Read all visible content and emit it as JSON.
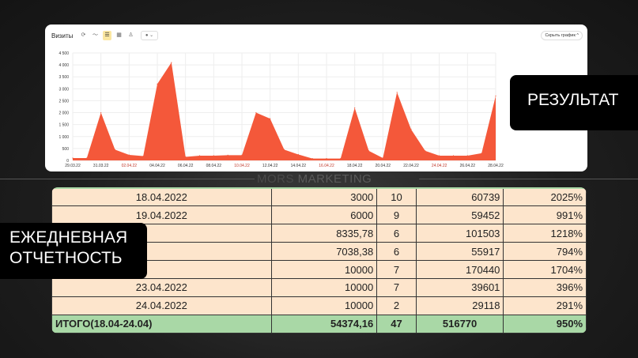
{
  "chart_card": {
    "title": "Визиты",
    "hide_button": "Скрыть график ^"
  },
  "chart_data": {
    "type": "area",
    "title": "Визиты",
    "color": "#f4583a",
    "x": [
      "29.03",
      "30.03",
      "31.03",
      "01.04",
      "02.04",
      "03.04",
      "04.04",
      "05.04",
      "06.04",
      "07.04",
      "08.04",
      "09.04",
      "10.04",
      "11.04",
      "12.04",
      "13.04",
      "14.04",
      "15.04",
      "16.04",
      "17.04",
      "18.04",
      "19.04",
      "20.04",
      "21.04",
      "22.04",
      "23.04",
      "24.04",
      "25.04",
      "26.04",
      "27.04",
      "28.04"
    ],
    "values": [
      100,
      100,
      2000,
      450,
      230,
      180,
      3200,
      4100,
      150,
      200,
      200,
      220,
      220,
      2000,
      1750,
      450,
      250,
      80,
      80,
      80,
      2200,
      400,
      100,
      2850,
      1300,
      400,
      200,
      200,
      200,
      300,
      2700
    ],
    "ylim": [
      0,
      4500
    ],
    "yticks": [
      "0",
      "500",
      "1 000",
      "1 500",
      "2 000",
      "2 500",
      "3 000",
      "3 500",
      "4 000",
      "4 500"
    ],
    "xticks": [
      {
        "label": "29.03.22",
        "weekend": false
      },
      {
        "label": "31.03.22",
        "weekend": false
      },
      {
        "label": "02.04.22",
        "weekend": true
      },
      {
        "label": "04.04.22",
        "weekend": false
      },
      {
        "label": "06.04.22",
        "weekend": false
      },
      {
        "label": "08.04.22",
        "weekend": false
      },
      {
        "label": "10.04.22",
        "weekend": true
      },
      {
        "label": "12.04.22",
        "weekend": false
      },
      {
        "label": "14.04.22",
        "weekend": false
      },
      {
        "label": "16.04.22",
        "weekend": true
      },
      {
        "label": "18.04.22",
        "weekend": false
      },
      {
        "label": "20.04.22",
        "weekend": false
      },
      {
        "label": "22.04.22",
        "weekend": false
      },
      {
        "label": "24.04.22",
        "weekend": true
      },
      {
        "label": "26.04.22",
        "weekend": false
      },
      {
        "label": "28.04.22",
        "weekend": false
      }
    ]
  },
  "labels": {
    "result": "РЕЗУЛЬТАТ",
    "daily_line1": "ЕЖЕДНЕВНАЯ",
    "daily_line2": "ОТЧЕТНОСТЬ"
  },
  "watermark": {
    "a": "MORS",
    "b": "MARKETING"
  },
  "table": {
    "rows": [
      [
        "18.04.2022",
        "3000",
        "10",
        "60739",
        "2025%"
      ],
      [
        "19.04.2022",
        "6000",
        "9",
        "59452",
        "991%"
      ],
      [
        "",
        "8335,78",
        "6",
        "101503",
        "1218%"
      ],
      [
        "",
        "7038,38",
        "6",
        "55917",
        "794%"
      ],
      [
        "",
        "10000",
        "7",
        "170440",
        "1704%"
      ],
      [
        "23.04.2022",
        "10000",
        "7",
        "39601",
        "396%"
      ],
      [
        "24.04.2022",
        "10000",
        "2",
        "29118",
        "291%"
      ]
    ],
    "total": [
      "ИТОГО(18.04-24.04)",
      "54374,16",
      "47",
      "516770",
      "950%"
    ]
  }
}
